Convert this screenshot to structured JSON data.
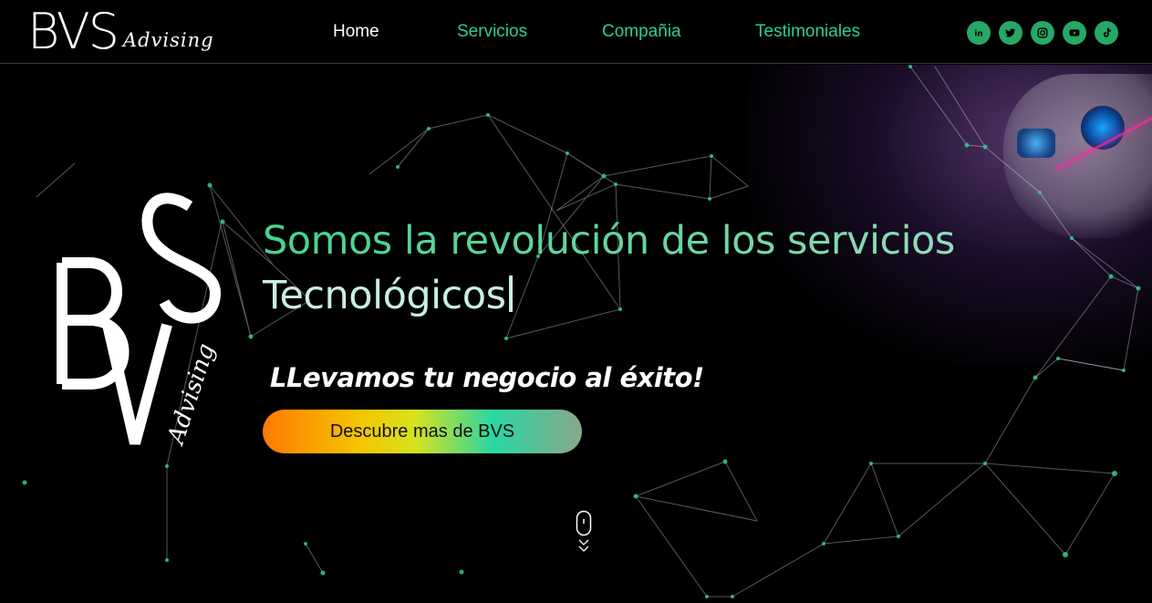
{
  "header": {
    "logo_main": "BVS",
    "logo_script": "Advising",
    "nav": [
      "Home",
      "Servicios",
      "Compañia",
      "Testimoniales"
    ],
    "nav_active": "Home",
    "socials": [
      "linkedin-icon",
      "twitter-icon",
      "instagram-icon",
      "youtube-icon",
      "tiktok-icon"
    ]
  },
  "hero": {
    "headline_line1": "Somos la revolución de los servicios",
    "headline_line2": "Tecnológicos",
    "tagline": "LLevamos tu negocio al éxito!",
    "cta_label": "Descubre mas de BVS",
    "big_logo_script": "Advising"
  },
  "colors": {
    "accent": "#2ecf8f",
    "background": "#000000",
    "social_bg": "#27a866"
  }
}
